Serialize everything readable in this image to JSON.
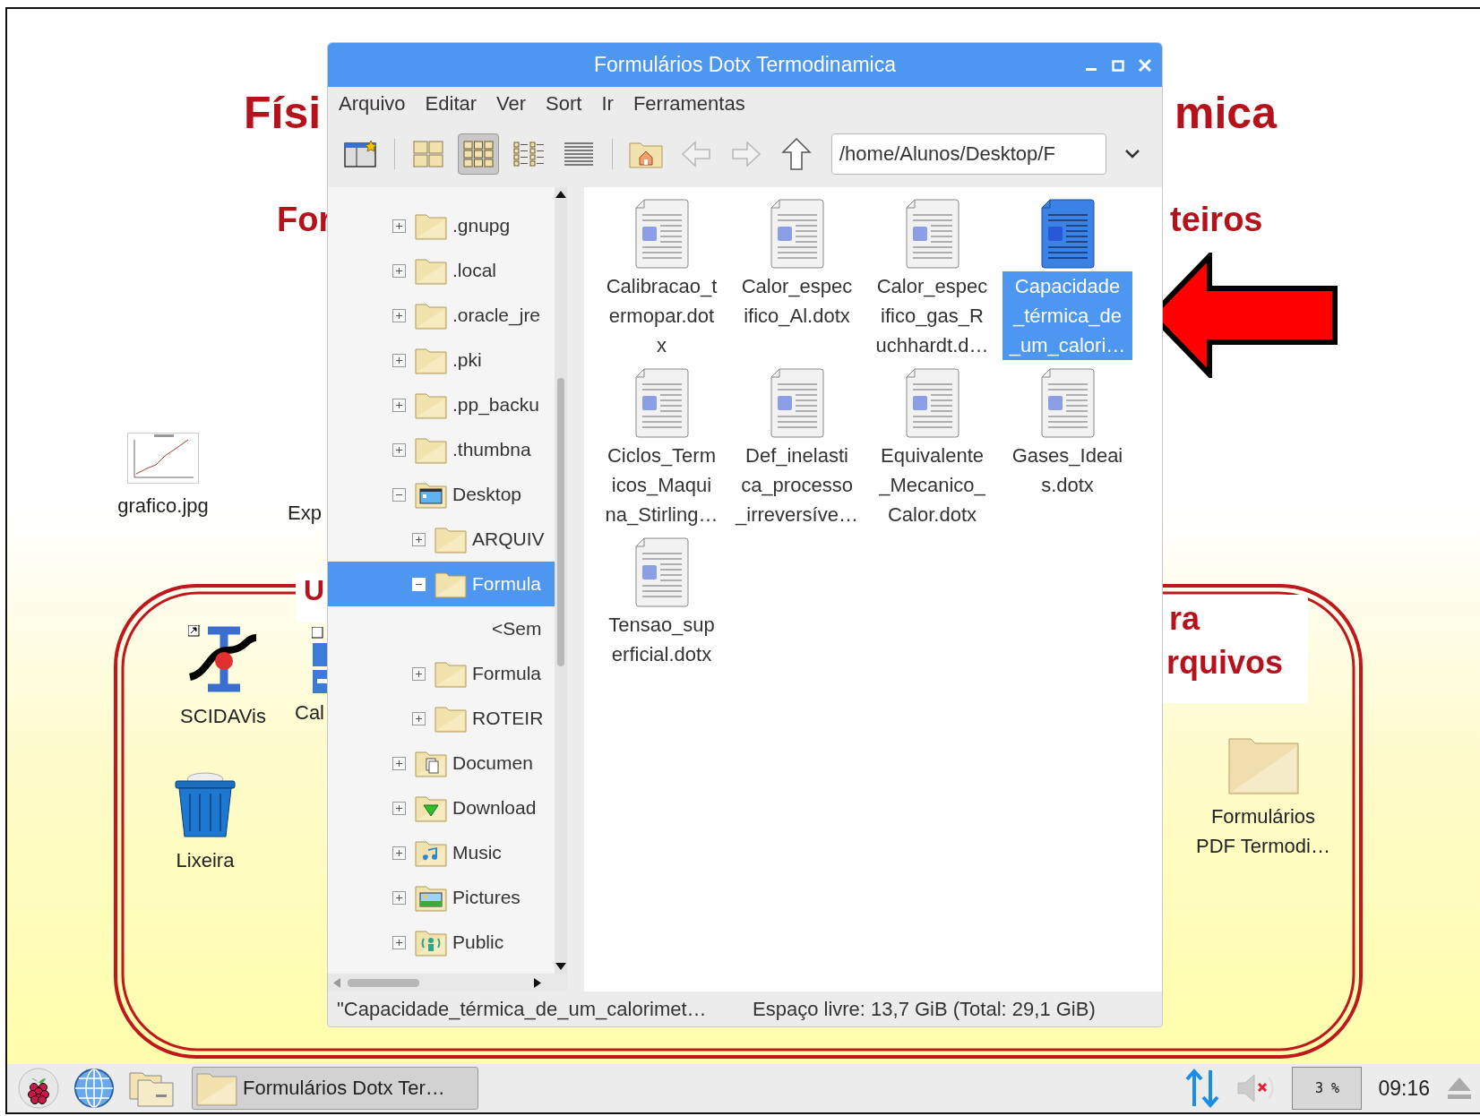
{
  "desktop_texts": [
    "Físi",
    "mica",
    "For",
    "teiros",
    "U",
    "ra",
    "rquivos"
  ],
  "desktop_icons": [
    {
      "label": "grafico.jpg",
      "kind": "chart"
    },
    {
      "label": "Exp",
      "kind": "partial"
    },
    {
      "label": "SCIDAVis",
      "kind": "scidavis"
    },
    {
      "label": "Cal",
      "kind": "app-partial"
    },
    {
      "label": "Lixeira",
      "kind": "trash"
    },
    {
      "label": "Formulários\nPDF Termodi…",
      "kind": "folder"
    }
  ],
  "window": {
    "title": "Formulários Dotx Termodinamica",
    "menu": [
      "Arquivo",
      "Editar",
      "Ver",
      "Sort",
      "Ir",
      "Ferramentas"
    ],
    "view_modes": [
      {
        "kind": "icons",
        "selected": false
      },
      {
        "kind": "thumbnails",
        "selected": true
      },
      {
        "kind": "compact",
        "selected": false
      },
      {
        "kind": "list",
        "selected": false
      }
    ],
    "nav": [
      {
        "kind": "back",
        "disabled": true
      },
      {
        "kind": "forward",
        "disabled": true
      },
      {
        "kind": "up",
        "disabled": false
      }
    ],
    "address": "/home/Alunos/Desktop/F",
    "tree": [
      {
        "label": ".gnupg",
        "kind": "folder",
        "expanded": false,
        "selected": false
      },
      {
        "label": ".local",
        "kind": "folder",
        "expanded": false,
        "selected": false
      },
      {
        "label": ".oracle_jre",
        "kind": "folder",
        "expanded": false,
        "selected": false
      },
      {
        "label": ".pki",
        "kind": "folder",
        "expanded": false,
        "selected": false
      },
      {
        "label": ".pp_backu",
        "kind": "folder",
        "expanded": false,
        "selected": false
      },
      {
        "label": ".thumbna",
        "kind": "folder",
        "expanded": false,
        "selected": false
      },
      {
        "label": "Desktop",
        "kind": "desktop",
        "expanded": true,
        "selected": false,
        "children": [
          {
            "label": "ARQUIV",
            "kind": "folder",
            "expanded": false,
            "selected": false
          },
          {
            "label": "Formula",
            "kind": "folder",
            "expanded": true,
            "selected": true,
            "children": [
              {
                "label": "<Sem",
                "kind": "placeholder",
                "selected": false
              }
            ]
          },
          {
            "label": "Formula",
            "kind": "folder",
            "expanded": false,
            "selected": false
          },
          {
            "label": "ROTEIR",
            "kind": "folder",
            "expanded": false,
            "selected": false
          }
        ]
      },
      {
        "label": "Documen",
        "kind": "documents",
        "expanded": false,
        "selected": false
      },
      {
        "label": "Download",
        "kind": "downloads",
        "expanded": false,
        "selected": false
      },
      {
        "label": "Music",
        "kind": "music",
        "expanded": false,
        "selected": false
      },
      {
        "label": "Pictures",
        "kind": "pictures",
        "expanded": false,
        "selected": false
      },
      {
        "label": "Public",
        "kind": "public",
        "expanded": false,
        "selected": false
      }
    ],
    "files": [
      {
        "name": "Calibracao_t\nermopar.dot\nx",
        "selected": false
      },
      {
        "name": "Calor_espec\nifico_Al.dotx",
        "selected": false
      },
      {
        "name": "Calor_espec\nifico_gas_R\nuchhardt.d…",
        "selected": false
      },
      {
        "name": "Capacidade\n_térmica_de\n_um_calori…",
        "selected": true
      },
      {
        "name": "Ciclos_Term\nicos_Maqui\nna_Stirling…",
        "selected": false
      },
      {
        "name": "Def_inelasti\nca_processo\n_irreversíve…",
        "selected": false
      },
      {
        "name": "Equivalente\n_Mecanico_\nCalor.dotx",
        "selected": false
      },
      {
        "name": "Gases_Ideai\ns.dotx",
        "selected": false
      },
      {
        "name": "Tensao_sup\nerficial.dotx",
        "selected": false
      }
    ],
    "status_bar": {
      "selection": "\"Capacidade_térmica_de_um_calorimet…",
      "free_space": "Espaço livre: 13,7 GiB (Total: 29,1 GiB)"
    }
  },
  "taskbar": {
    "task": "Formulários Dotx Ter…",
    "volume_muted": true,
    "cpu": "3 %",
    "clock": "09:16"
  }
}
